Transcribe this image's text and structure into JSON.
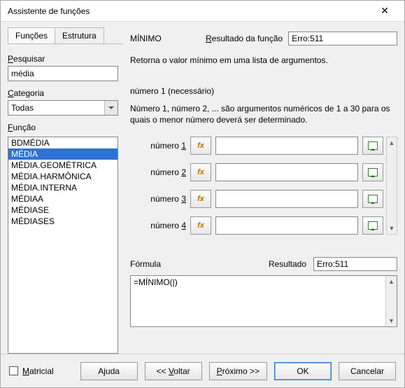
{
  "window": {
    "title": "Assistente de funções"
  },
  "tabs": {
    "functions": "Funções",
    "structure": "Estrutura",
    "active": "functions"
  },
  "search": {
    "label_pre": "P",
    "label_rest": "esquisar",
    "value": "média"
  },
  "category": {
    "label_pre": "C",
    "label_rest": "ategoria",
    "value": "Todas"
  },
  "function_label": {
    "pre": "F",
    "rest": "unção"
  },
  "function_list": [
    "BDMÉDIA",
    "MÉDIA",
    "MÉDIA.GEOMÉTRICA",
    "MÉDIA.HARMÔNICA",
    "MÉDIA.INTERNA",
    "MÉDIAA",
    "MÉDIASE",
    "MÉDIASES"
  ],
  "function_selected_index": 1,
  "current_function": "MÍNIMO",
  "top_result": {
    "label_pre": "R",
    "label_rest": "esultado da função",
    "value": "Erro:511"
  },
  "description": "Retorna o valor mínimo em uma lista de argumentos.",
  "arg_header": "número 1 (necessário)",
  "arg_help": "Número 1, número 2, ... são argumentos numéricos de 1 a 30 para os quais o menor número deverá ser determinado.",
  "args": [
    {
      "label": "número",
      "accel": "1",
      "value": ""
    },
    {
      "label": "número",
      "accel": "2",
      "value": ""
    },
    {
      "label": "número",
      "accel": "3",
      "value": ""
    },
    {
      "label": "número",
      "accel": "4",
      "value": ""
    }
  ],
  "formula": {
    "label": "Fórmula",
    "value": "=MÍNIMO("
  },
  "bottom_result": {
    "label": "Resultado",
    "value": "Erro:511"
  },
  "matrix": {
    "pre": "M",
    "rest": "atricial",
    "checked": false
  },
  "buttons": {
    "help": "Ajuda",
    "back_pre": "<< ",
    "back_accel": "V",
    "back_rest": "oltar",
    "next_pre": "P",
    "next_accel": "r",
    "next_rest": "óximo >>",
    "ok": "OK",
    "cancel": "Cancelar"
  }
}
